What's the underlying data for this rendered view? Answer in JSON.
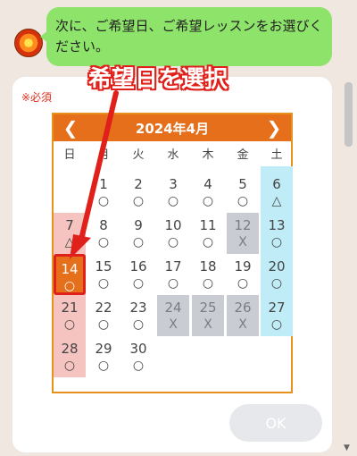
{
  "chat": {
    "avatar_icon": "sun-avatar-icon",
    "message": "次に、ご希望日、ご希望レッスンをお選びください。"
  },
  "form": {
    "required_label": "※必須",
    "ok_label": "OK"
  },
  "annotation": {
    "callout": "希望日を選択"
  },
  "calendar": {
    "title": "2024年4月",
    "prev_icon": "chevron-left-icon",
    "next_icon": "chevron-right-icon",
    "prev_symbol": "❮",
    "next_symbol": "❯",
    "weekdays": [
      "日",
      "月",
      "火",
      "水",
      "木",
      "金",
      "土"
    ],
    "colors": {
      "header": "#e56f1b",
      "border": "#e8901d",
      "sunday": "#f5c3c0",
      "saturday": "#c0ecf7",
      "unavailable": "#c9ccd2",
      "annotation": "#e0201a"
    },
    "days": [
      {
        "day": "1",
        "mark": "○",
        "col": 1,
        "row": 0
      },
      {
        "day": "2",
        "mark": "○",
        "col": 2,
        "row": 0
      },
      {
        "day": "3",
        "mark": "○",
        "col": 3,
        "row": 0
      },
      {
        "day": "4",
        "mark": "○",
        "col": 4,
        "row": 0
      },
      {
        "day": "5",
        "mark": "○",
        "col": 5,
        "row": 0
      },
      {
        "day": "6",
        "mark": "△",
        "col": 6,
        "row": 0
      },
      {
        "day": "7",
        "mark": "△",
        "col": 0,
        "row": 1
      },
      {
        "day": "8",
        "mark": "○",
        "col": 1,
        "row": 1
      },
      {
        "day": "9",
        "mark": "○",
        "col": 2,
        "row": 1
      },
      {
        "day": "10",
        "mark": "○",
        "col": 3,
        "row": 1
      },
      {
        "day": "11",
        "mark": "○",
        "col": 4,
        "row": 1
      },
      {
        "day": "12",
        "mark": "X",
        "col": 5,
        "row": 1,
        "state": "unavailable"
      },
      {
        "day": "13",
        "mark": "○",
        "col": 6,
        "row": 1
      },
      {
        "day": "14",
        "mark": "○",
        "col": 0,
        "row": 2,
        "state": "selected"
      },
      {
        "day": "15",
        "mark": "○",
        "col": 1,
        "row": 2
      },
      {
        "day": "16",
        "mark": "○",
        "col": 2,
        "row": 2
      },
      {
        "day": "17",
        "mark": "○",
        "col": 3,
        "row": 2
      },
      {
        "day": "18",
        "mark": "○",
        "col": 4,
        "row": 2
      },
      {
        "day": "19",
        "mark": "○",
        "col": 5,
        "row": 2
      },
      {
        "day": "20",
        "mark": "○",
        "col": 6,
        "row": 2
      },
      {
        "day": "21",
        "mark": "○",
        "col": 0,
        "row": 3
      },
      {
        "day": "22",
        "mark": "○",
        "col": 1,
        "row": 3
      },
      {
        "day": "23",
        "mark": "○",
        "col": 2,
        "row": 3
      },
      {
        "day": "24",
        "mark": "X",
        "col": 3,
        "row": 3,
        "state": "unavailable"
      },
      {
        "day": "25",
        "mark": "X",
        "col": 4,
        "row": 3,
        "state": "unavailable"
      },
      {
        "day": "26",
        "mark": "X",
        "col": 5,
        "row": 3,
        "state": "unavailable"
      },
      {
        "day": "27",
        "mark": "○",
        "col": 6,
        "row": 3
      },
      {
        "day": "28",
        "mark": "○",
        "col": 0,
        "row": 4
      },
      {
        "day": "29",
        "mark": "○",
        "col": 1,
        "row": 4
      },
      {
        "day": "30",
        "mark": "○",
        "col": 2,
        "row": 4
      }
    ]
  }
}
